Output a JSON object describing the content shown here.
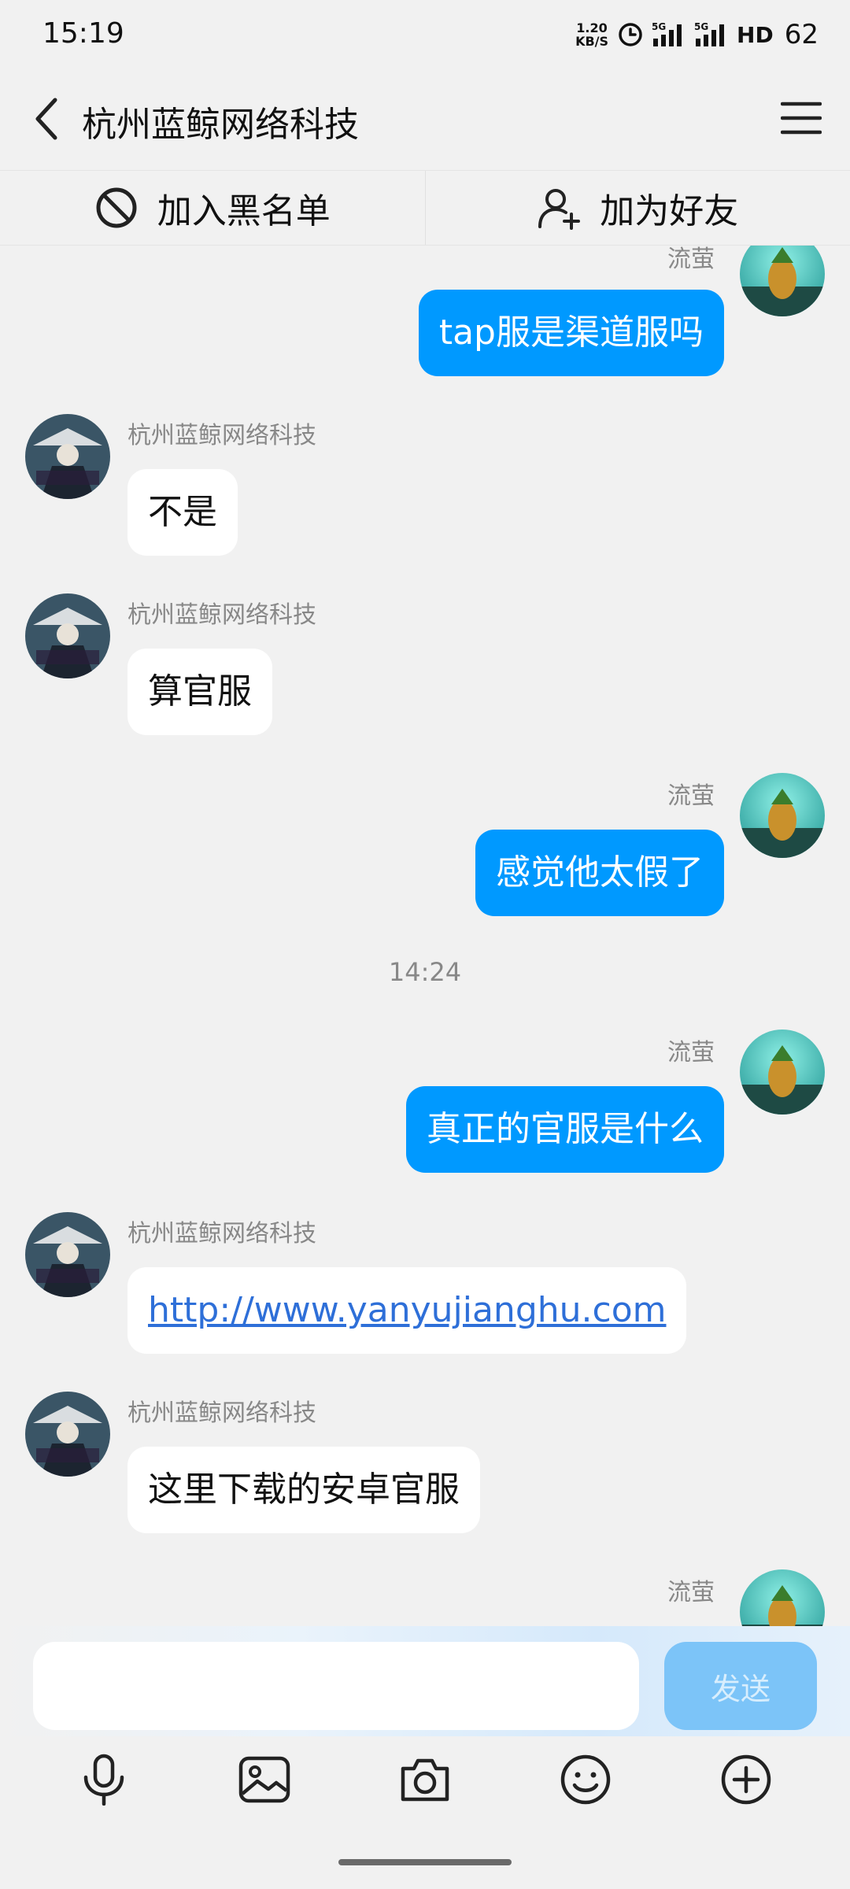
{
  "status_bar": {
    "time": "15:19",
    "net_speed_value": "1.20",
    "net_speed_unit": "KB/S",
    "hd_label": "HD",
    "battery": "62",
    "icons": [
      "alarm-icon",
      "signal-5g-icon",
      "signal-5g-icon"
    ]
  },
  "header": {
    "title": "杭州蓝鲸网络科技",
    "back_icon": "chevron-left-icon",
    "menu_icon": "hamburger-menu-icon"
  },
  "actions": {
    "block_label": "加入黑名单",
    "add_friend_label": "加为好友"
  },
  "messages": [
    {
      "from": "流萤",
      "side": "out",
      "text": "tap服是渠道服吗"
    },
    {
      "from": "杭州蓝鲸网络科技",
      "side": "in",
      "text": "不是"
    },
    {
      "from": "杭州蓝鲸网络科技",
      "side": "in",
      "text": "算官服"
    },
    {
      "from": "流萤",
      "side": "out",
      "text": "感觉他太假了"
    },
    {
      "type": "time",
      "text": "14:24"
    },
    {
      "from": "流萤",
      "side": "out",
      "text": "真正的官服是什么"
    },
    {
      "from": "杭州蓝鲸网络科技",
      "side": "in",
      "text": "http://www.yanyujianghu.com",
      "is_link": true
    },
    {
      "from": "杭州蓝鲸网络科技",
      "side": "in",
      "text": "这里下载的安卓官服"
    },
    {
      "from": "流萤",
      "side": "out",
      "text": ""
    }
  ],
  "input": {
    "value": "",
    "placeholder": "",
    "send_label": "发送"
  },
  "toolbar": [
    "microphone-icon",
    "image-icon",
    "camera-icon",
    "emoji-icon",
    "plus-circle-icon"
  ],
  "colors": {
    "outgoing_bubble": "#0099ff",
    "incoming_bubble": "#ffffff",
    "link": "#2e6fd8",
    "background": "#f1f1f1",
    "send_button": "#7cc4f8"
  }
}
